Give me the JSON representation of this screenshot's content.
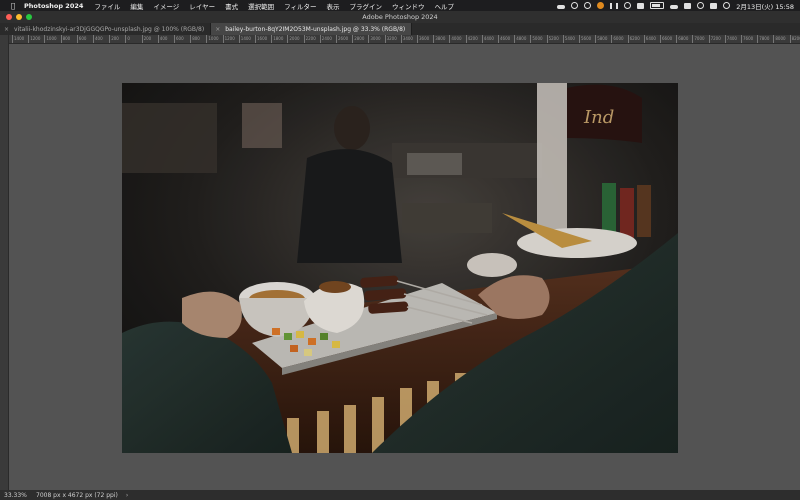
{
  "menubar": {
    "app_name": "Photoshop 2024",
    "menus": [
      "ファイル",
      "編集",
      "イメージ",
      "レイヤー",
      "書式",
      "選択範囲",
      "フィルター",
      "表示",
      "プラグイン",
      "ウィンドウ",
      "ヘルプ"
    ],
    "datetime": "2月13日(火) 15:58"
  },
  "window": {
    "title": "Adobe Photoshop 2024"
  },
  "tabs": [
    {
      "label": "vitalii-khodzinskyi-ar3DjGGQGPo-unsplash.jpg @ 100% (RGB/8)",
      "active": false
    },
    {
      "label": "bailey-burton-8qY2IM2O53M-unsplash.jpg @ 33.3% (RGB/8)",
      "active": true
    }
  ],
  "ruler": {
    "ticks": [
      "1400",
      "1200",
      "1000",
      "800",
      "600",
      "400",
      "200",
      "0",
      "200",
      "400",
      "600",
      "800",
      "1000",
      "1200",
      "1400",
      "1600",
      "1800",
      "2000",
      "2200",
      "2400",
      "2600",
      "2800",
      "3000",
      "3200",
      "3400",
      "3600",
      "3800",
      "4000",
      "4200",
      "4400",
      "4600",
      "4800",
      "5000",
      "5200",
      "5400",
      "5600",
      "5800",
      "6000",
      "6200",
      "6400",
      "6600",
      "6800",
      "7000",
      "7200",
      "7400",
      "7600",
      "7800",
      "8000",
      "8200"
    ]
  },
  "statusbar": {
    "zoom": "33.33%",
    "doc_info": "7008 px x 4672 px (72 ppi)",
    "arrow": "›"
  },
  "colors": {
    "canvas_bg": "#535353",
    "menubar_bg": "#1d1d1f"
  }
}
